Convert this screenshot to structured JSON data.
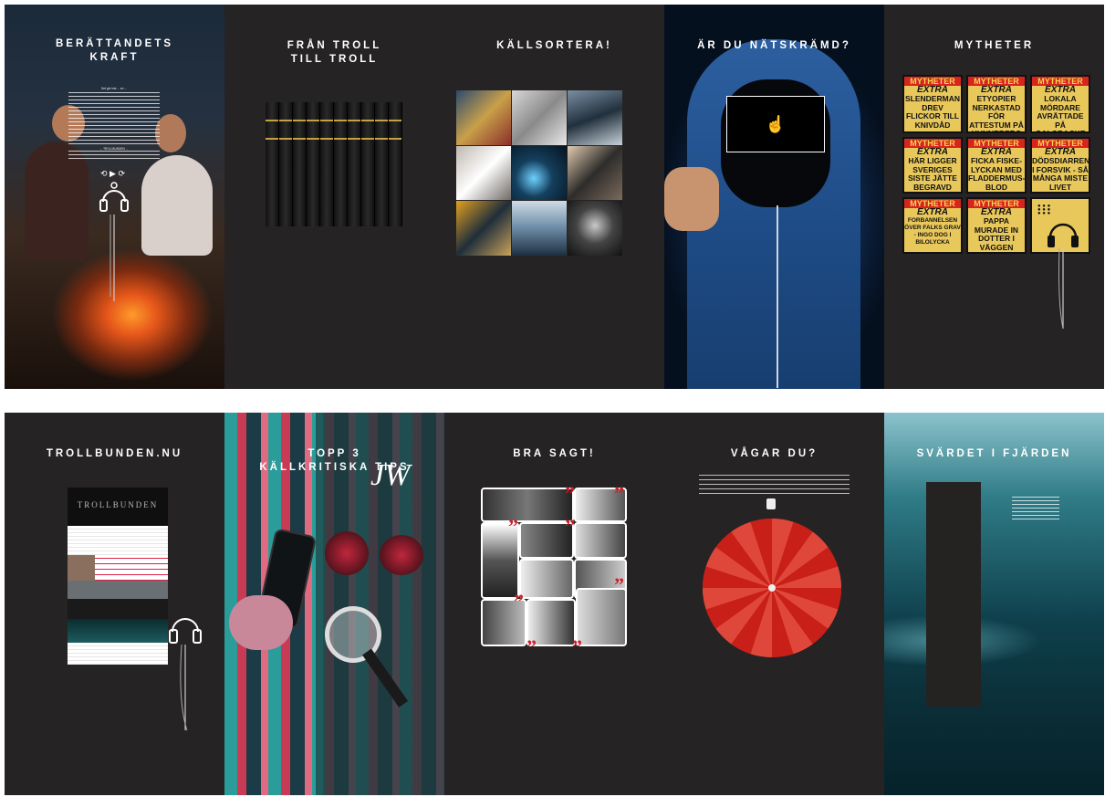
{
  "colors": {
    "panel_bg": "#262324",
    "accent_red": "#d01f2a",
    "tabloid_yellow": "#e9c85b",
    "wheel_red": "#d62a22"
  },
  "panels": [
    {
      "title": "BERÄTTANDETS\nKRAFT",
      "body": [
        "Det gör inte ... en ... ",
        "... TROLLBUNDEN ..."
      ],
      "icon_names": [
        "headphones-icon",
        "controls-icon"
      ]
    },
    {
      "title": "FRÅN TROLL\nTILL TROLL",
      "image": "books-row"
    },
    {
      "title": "KÄLLSORTERA!",
      "image": "photo-grid"
    },
    {
      "title": "ÄR DU NÄTSKRÄMD?",
      "icon_names": [
        "hand-pointer-icon"
      ]
    },
    {
      "title": "MYTHETER",
      "tabloids": [
        {
          "head": "MYTHETER",
          "extra": "EXTRA",
          "headline": "SLENDERMAN DREV FLICKOR TILL KNIVDÅD"
        },
        {
          "head": "MYTHETER",
          "extra": "EXTRA",
          "headline": "ETYOPIER NERKASTAD FÖR ATTESTUM PÅ HUNNEBERG"
        },
        {
          "head": "MYTHETER",
          "extra": "EXTRA",
          "headline": "LOKALA MÖRDARE AVRÄTTADE PÅ GALGBACKE"
        },
        {
          "head": "MYTHETER",
          "extra": "EXTRA",
          "headline": "HÄR LIGGER SVERIGES SISTE JÄTTE BEGRAVD"
        },
        {
          "head": "MYTHETER",
          "extra": "EXTRA",
          "headline": "FICKA FISKE-LYCKAN MED FLADDERMUS-BLOD"
        },
        {
          "head": "MYTHETER",
          "extra": "EXTRA",
          "headline": "DÖDSDIARREN I FORSVIK - SÅ MÅNGA MISTE LIVET"
        },
        {
          "head": "MYTHETER",
          "extra": "EXTRA",
          "headline": "FORBANNELSEN ÖVER FALKS GRAV - INGO DOG I BILOLYCKA"
        },
        {
          "head": "MYTHETER",
          "extra": "EXTRA",
          "headline": "PAPPA MURADE IN DOTTER I VÄGGEN"
        }
      ]
    },
    {
      "title": "TROLLBUNDEN.NU",
      "site_title": "TROLLBUNDEN"
    },
    {
      "title": "TOPP 3\nKÄLLKRITISKA TIPS",
      "signature": "JW"
    },
    {
      "title": "BRA SAGT!"
    },
    {
      "title": "VÅGAR DU?"
    },
    {
      "title": "SVÄRDET I FJÄRDEN"
    }
  ]
}
